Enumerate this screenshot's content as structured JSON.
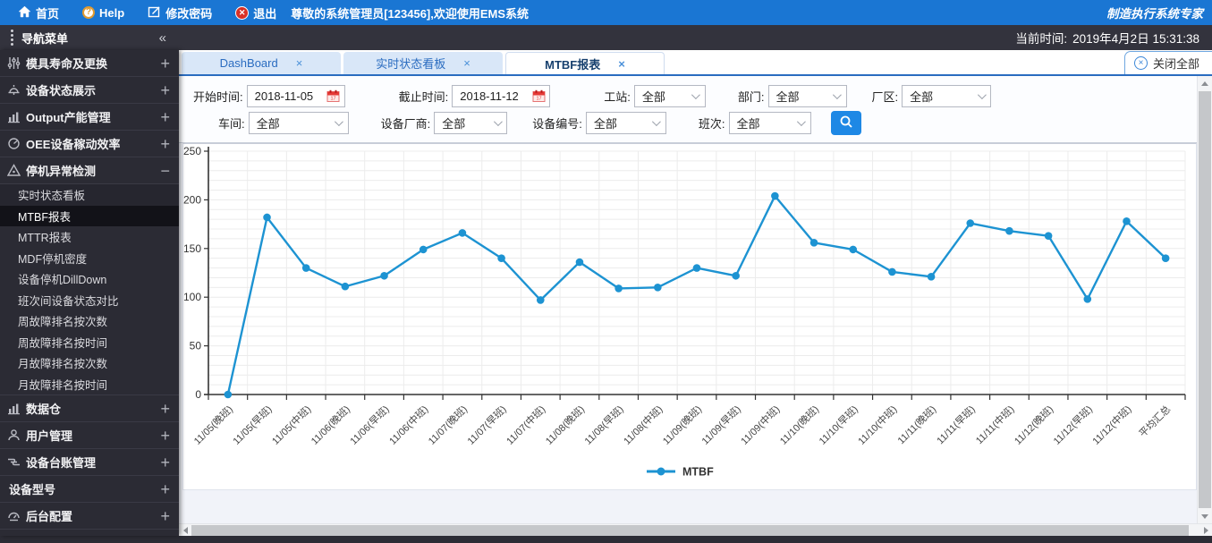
{
  "topbar": {
    "home_label": "首页",
    "help_label": "Help",
    "change_password_label": "修改密码",
    "logout_label": "退出",
    "logout_glyph": "✕",
    "help_glyph": "?",
    "welcome": "尊敬的系统管理员[123456],欢迎使用EMS系统",
    "brand": "制造执行系统专家"
  },
  "statusbar": {
    "nav_title": "导航菜单",
    "collapse_glyph": "«",
    "time_label": "当前时间:",
    "time_value": "2019年4月2日 15:31:38"
  },
  "sidebar": {
    "items": [
      {
        "label": "模具寿命及更换",
        "icon": "sliders-icon",
        "expand": "+"
      },
      {
        "label": "设备状态展示",
        "icon": "bell-icon",
        "expand": "+"
      },
      {
        "label": "Output产能管理",
        "icon": "bar-chart-icon",
        "expand": "+"
      },
      {
        "label": "OEE设备稼动效率",
        "icon": "gauge-icon",
        "expand": "+"
      },
      {
        "label": "停机异常检测",
        "icon": "warning-triangle-icon",
        "expand": "−",
        "expanded": true,
        "children": [
          "实时状态看板",
          "MTBF报表",
          "MTTR报表",
          "MDF停机密度",
          "设备停机DillDown",
          "班次间设备状态对比",
          "周故障排名按次数",
          "周故障排名按时间",
          "月故障排名按次数",
          "月故障排名按时间"
        ],
        "active_child": "MTBF报表"
      },
      {
        "label": "数据仓",
        "icon": "bar-chart-icon",
        "expand": "+"
      },
      {
        "label": "用户管理",
        "icon": "user-icon",
        "expand": "+"
      },
      {
        "label": "设备台账管理",
        "icon": "shuffle-icon",
        "expand": "+"
      },
      {
        "label": "设备型号",
        "icon": null,
        "expand": "+"
      },
      {
        "label": "后台配置",
        "icon": "dashboard-icon",
        "expand": "+"
      }
    ]
  },
  "tabs": {
    "items": [
      {
        "label": "DashBoard",
        "active": false
      },
      {
        "label": "实时状态看板",
        "active": false
      },
      {
        "label": "MTBF报表",
        "active": true
      }
    ],
    "close_glyph": "×",
    "close_all_label": "关闭全部"
  },
  "filters": {
    "row1": [
      {
        "label": "开始时间:",
        "type": "date",
        "value": "2018-11-05"
      },
      {
        "label": "截止时间:",
        "type": "date",
        "value": "2018-11-12"
      },
      {
        "label": "工站:",
        "type": "select",
        "value": "全部"
      },
      {
        "label": "部门:",
        "type": "select",
        "value": "全部"
      },
      {
        "label": "厂区:",
        "type": "select",
        "value": "全部"
      }
    ],
    "row2": [
      {
        "label": "车间:",
        "type": "select",
        "value": "全部"
      },
      {
        "label": "设备厂商:",
        "type": "select",
        "value": "全部"
      },
      {
        "label": "设备编号:",
        "type": "select",
        "value": "全部"
      },
      {
        "label": "班次:",
        "type": "select",
        "value": "全部"
      }
    ]
  },
  "chart_data": {
    "type": "line",
    "categories": [
      "11/05(晚班)",
      "11/05(早班)",
      "11/05(中班)",
      "11/06(晚班)",
      "11/06(早班)",
      "11/06(中班)",
      "11/07(晚班)",
      "11/07(早班)",
      "11/07(中班)",
      "11/08(晚班)",
      "11/08(早班)",
      "11/08(中班)",
      "11/09(晚班)",
      "11/09(早班)",
      "11/09(中班)",
      "11/10(晚班)",
      "11/10(早班)",
      "11/10(中班)",
      "11/11(晚班)",
      "11/11(早班)",
      "11/11(中班)",
      "11/12(晚班)",
      "11/12(早班)",
      "11/12(中班)",
      "平均汇总"
    ],
    "series": [
      {
        "name": "MTBF",
        "values": [
          0,
          182,
          130,
          111,
          122,
          149,
          166,
          140,
          97,
          136,
          109,
          110,
          130,
          122,
          204,
          156,
          149,
          126,
          121,
          176,
          168,
          163,
          98,
          178,
          140
        ]
      }
    ],
    "title": "",
    "xlabel": "",
    "ylabel": "",
    "ylim": [
      0,
      250
    ],
    "y_ticks": [
      0,
      50,
      100,
      150,
      200,
      250
    ],
    "grid": true,
    "legend": [
      "MTBF"
    ],
    "legend_position": "bottom",
    "line_color": "#1d93d2"
  },
  "colors": {
    "topbar_blue": "#1a76d3",
    "dark_bar": "#33333d",
    "sidebar_bg": "#2b2b34",
    "accent_blue": "#1e88e5",
    "tab_inactive_bg": "#d9e7f8",
    "line_color": "#1d93d2"
  }
}
